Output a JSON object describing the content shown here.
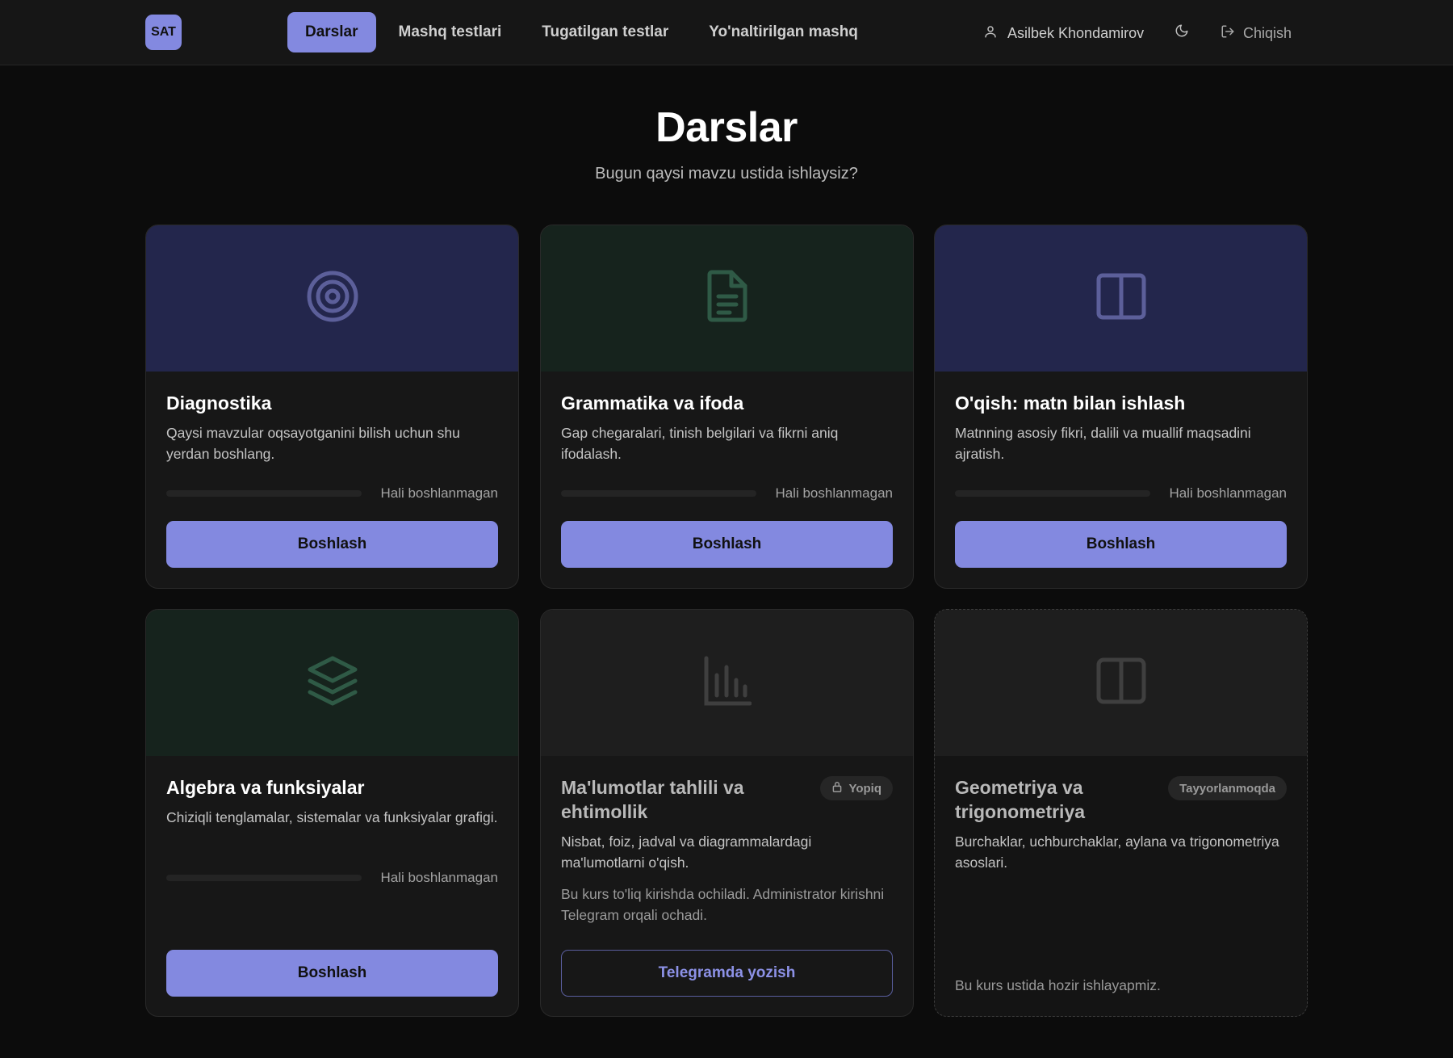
{
  "header": {
    "logo_text": "SAT",
    "nav": [
      {
        "label": "Darslar",
        "active": true
      },
      {
        "label": "Mashq testlari",
        "active": false
      },
      {
        "label": "Tugatilgan testlar",
        "active": false
      },
      {
        "label": "Yo'naltirilgan mashq",
        "active": false
      }
    ],
    "user_name": "Asilbek Khondamirov",
    "logout_label": "Chiqish"
  },
  "page": {
    "title": "Darslar",
    "subtitle": "Bugun qaysi mavzu ustida ishlaysiz?"
  },
  "colors": {
    "accent": "#8389e0",
    "hero_indigo": "#23264c",
    "hero_green": "#16231d",
    "hero_gray": "#1e1e1e"
  },
  "cards": [
    {
      "title": "Diagnostika",
      "description": "Qaysi mavzular oqsayotganini bilish uchun shu yerdan boshlang.",
      "icon": "target-icon",
      "progress": 0,
      "status": "Hali boshlanmagan",
      "button": "Boshlash"
    },
    {
      "title": "Grammatika va ifoda",
      "description": "Gap chegaralari, tinish belgilari va fikrni aniq ifodalash.",
      "icon": "document-icon",
      "progress": 0,
      "status": "Hali boshlanmagan",
      "button": "Boshlash"
    },
    {
      "title": "O'qish: matn bilan ishlash",
      "description": "Matnning asosiy fikri, dalili va muallif maqsadini ajratish.",
      "icon": "book-open-icon",
      "progress": 0,
      "status": "Hali boshlanmagan",
      "button": "Boshlash"
    },
    {
      "title": "Algebra va funksiyalar",
      "description": "Chiziqli tenglamalar, sistemalar va funksiyalar grafigi.",
      "icon": "layers-icon",
      "progress": 0,
      "status": "Hali boshlanmagan",
      "button": "Boshlash"
    },
    {
      "title": "Ma'lumotlar tahlili va ehtimollik",
      "description": "Nisbat, foiz, jadval va diagrammalardagi ma'lumotlarni o'qish.",
      "note": "Bu kurs to'liq kirishda ochiladi. Administrator kirishni Telegram orqali ochadi.",
      "icon": "bar-chart-icon",
      "badge": "Yopiq",
      "button": "Telegramda yozish"
    },
    {
      "title": "Geometriya va trigonometriya",
      "description": "Burchaklar, uchburchaklar, aylana va trigonometriya asoslari.",
      "icon": "columns-icon",
      "badge": "Tayyorlanmoqda",
      "footnote": "Bu kurs ustida hozir ishlayapmiz."
    }
  ]
}
